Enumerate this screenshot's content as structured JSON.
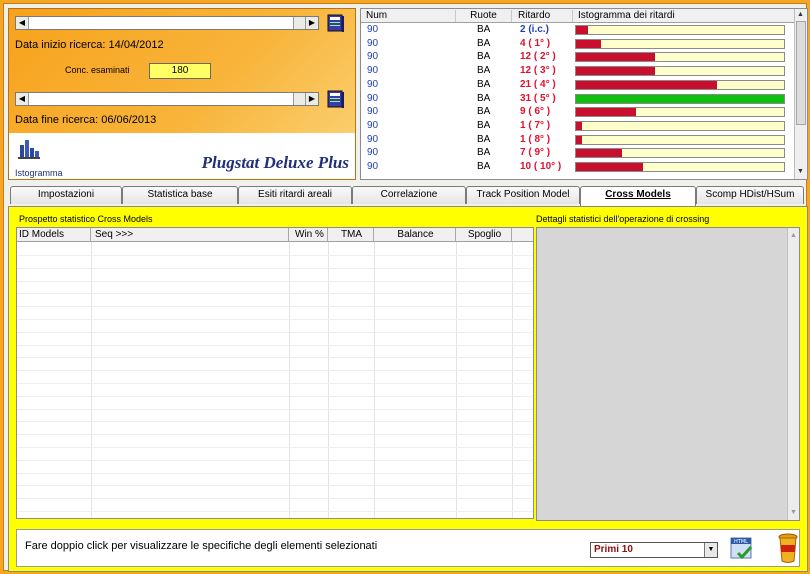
{
  "left_panel": {
    "data_inizio": "Data inizio ricerca: 14/04/2012",
    "conc_label": "Conc. esaminati",
    "conc_value": "180",
    "data_fine": "Data fine ricerca: 06/06/2013",
    "brand": "Plugstat Deluxe Plus",
    "istogramma_label": "Istogramma",
    "slider_left_arrow": "◀",
    "slider_right_arrow": "▶"
  },
  "ritardi_grid": {
    "columns": [
      "Num",
      "Ruote",
      "Ritardo",
      "Istogramma dei ritardi"
    ],
    "rows": [
      {
        "num": "90",
        "ruote": "BA",
        "ritardo": "2  (i.c.)",
        "fill": 0.06,
        "color": "#c8102e",
        "ritardo_color": "#1f3fbf"
      },
      {
        "num": "90",
        "ruote": "BA",
        "ritardo": "4  ( 1° )",
        "fill": 0.12,
        "color": "#c8102e",
        "ritardo_color": "#e0102e"
      },
      {
        "num": "90",
        "ruote": "BA",
        "ritardo": "12  ( 2° )",
        "fill": 0.38,
        "color": "#c8102e",
        "ritardo_color": "#e0102e"
      },
      {
        "num": "90",
        "ruote": "BA",
        "ritardo": "12  ( 3° )",
        "fill": 0.38,
        "color": "#c8102e",
        "ritardo_color": "#e0102e"
      },
      {
        "num": "90",
        "ruote": "BA",
        "ritardo": "21  ( 4° )",
        "fill": 0.68,
        "color": "#c8102e",
        "ritardo_color": "#e0102e"
      },
      {
        "num": "90",
        "ruote": "BA",
        "ritardo": "31  ( 5° )",
        "fill": 1.0,
        "color": "#10c010",
        "ritardo_color": "#e0102e"
      },
      {
        "num": "90",
        "ruote": "BA",
        "ritardo": "9  ( 6° )",
        "fill": 0.29,
        "color": "#c8102e",
        "ritardo_color": "#e0102e"
      },
      {
        "num": "90",
        "ruote": "BA",
        "ritardo": "1  ( 7° )",
        "fill": 0.03,
        "color": "#c8102e",
        "ritardo_color": "#e0102e"
      },
      {
        "num": "90",
        "ruote": "BA",
        "ritardo": "1  ( 8° )",
        "fill": 0.03,
        "color": "#c8102e",
        "ritardo_color": "#e0102e"
      },
      {
        "num": "90",
        "ruote": "BA",
        "ritardo": "7  ( 9° )",
        "fill": 0.22,
        "color": "#c8102e",
        "ritardo_color": "#e0102e"
      },
      {
        "num": "90",
        "ruote": "BA",
        "ritardo": "10  ( 10° )",
        "fill": 0.32,
        "color": "#c8102e",
        "ritardo_color": "#e0102e"
      }
    ]
  },
  "tabs": [
    {
      "label": "Impostazioni",
      "active": false
    },
    {
      "label": "Statistica base",
      "active": false
    },
    {
      "label": "Esiti ritardi areali",
      "active": false
    },
    {
      "label": "Correlazione",
      "active": false
    },
    {
      "label": "Track Position Model",
      "active": false
    },
    {
      "label": "Cross Models",
      "active": true
    },
    {
      "label": "Scomp HDist/HSum",
      "active": false
    }
  ],
  "cross_models": {
    "title": "Prospetto statistico Cross Models",
    "columns": [
      "ID Models",
      "Seq >>>",
      "Win %",
      "TMA",
      "Balance",
      "Spoglio"
    ]
  },
  "details": {
    "title": "Dettagli statistici dell'operazione di crossing"
  },
  "bottom": {
    "hint": "Fare doppio click per visualizzare le specifiche degli elementi selezionati",
    "select_value": "Primi 10"
  },
  "colors": {
    "accent_orange": "#f5a623",
    "panel_yellow": "#ffff00",
    "bar_red": "#c8102e",
    "bar_green": "#10c010"
  }
}
